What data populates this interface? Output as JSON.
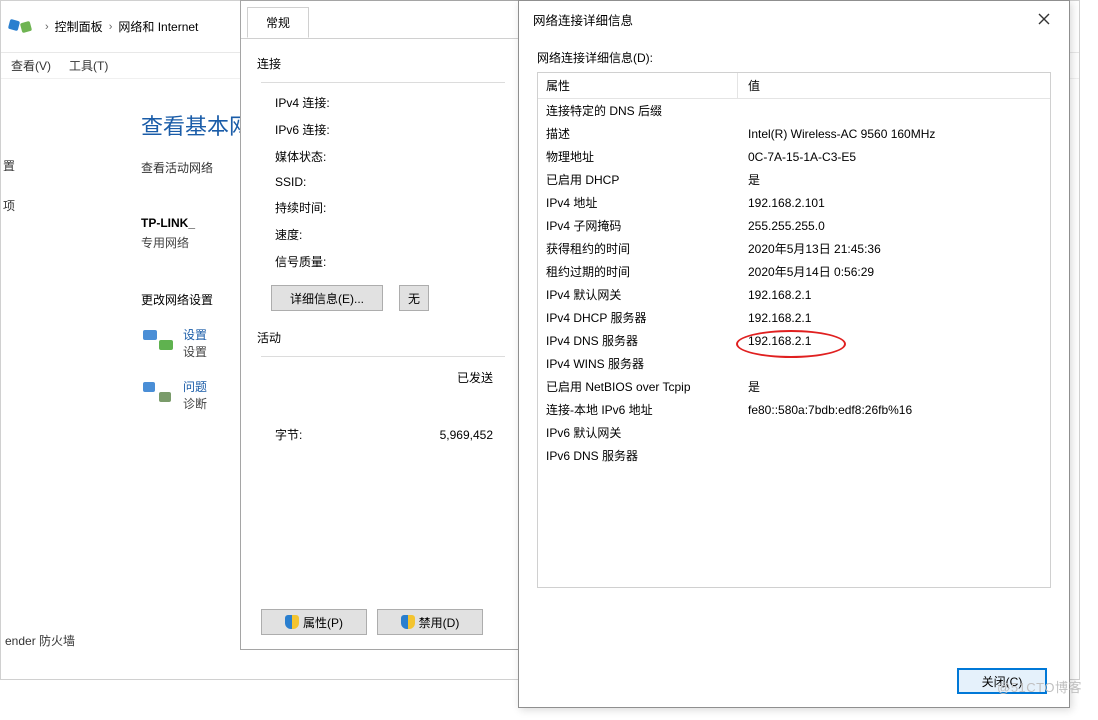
{
  "bg": {
    "breadcrumb": {
      "item1": "控制面板",
      "item2": "网络和 Internet"
    },
    "menu": {
      "view": "查看(V)",
      "tools": "工具(T)"
    },
    "heading": "查看基本网",
    "sub": "查看活动网络",
    "ssid_label": "TP-LINK_",
    "ssid_sub": "专用网络",
    "section": "更改网络设置",
    "link1": "设置",
    "link1_sub": "设置",
    "link2": "问题",
    "link2_sub": "诊断",
    "left": {
      "a": "置",
      "b": "项"
    },
    "footer": "ender 防火墙"
  },
  "mid": {
    "tab": "常规",
    "conn_title": "连接",
    "rows": {
      "ipv4": "IPv4 连接:",
      "ipv6": "IPv6 连接:",
      "media": "媒体状态:",
      "ssid": "SSID:",
      "duration": "持续时间:",
      "speed": "速度:",
      "signal": "信号质量:"
    },
    "btn_details": "详细信息(E)...",
    "btn_wireless_prefix": "无",
    "activity_title": "活动",
    "sent_label": "已发送",
    "bytes_label": "字节:",
    "bytes_sent": "5,969,452",
    "btn_props": "属性(P)",
    "btn_disable": "禁用(D)"
  },
  "front": {
    "title": "网络连接详细信息",
    "list_label": "网络连接详细信息(D):",
    "col_prop": "属性",
    "col_val": "值",
    "rows": [
      {
        "p": "连接特定的 DNS 后缀",
        "v": ""
      },
      {
        "p": "描述",
        "v": "Intel(R) Wireless-AC 9560 160MHz"
      },
      {
        "p": "物理地址",
        "v": "0C-7A-15-1A-C3-E5"
      },
      {
        "p": "已启用 DHCP",
        "v": "是"
      },
      {
        "p": "IPv4 地址",
        "v": "192.168.2.101"
      },
      {
        "p": "IPv4 子网掩码",
        "v": "255.255.255.0"
      },
      {
        "p": "获得租约的时间",
        "v": "2020年5月13日 21:45:36"
      },
      {
        "p": "租约过期的时间",
        "v": "2020年5月14日 0:56:29"
      },
      {
        "p": "IPv4 默认网关",
        "v": "192.168.2.1"
      },
      {
        "p": "IPv4 DHCP 服务器",
        "v": "192.168.2.1"
      },
      {
        "p": "IPv4 DNS 服务器",
        "v": "192.168.2.1"
      },
      {
        "p": "IPv4 WINS 服务器",
        "v": ""
      },
      {
        "p": "已启用 NetBIOS over Tcpip",
        "v": "是"
      },
      {
        "p": "连接-本地 IPv6 地址",
        "v": "fe80::580a:7bdb:edf8:26fb%16"
      },
      {
        "p": "IPv6 默认网关",
        "v": ""
      },
      {
        "p": "IPv6 DNS 服务器",
        "v": ""
      }
    ],
    "btn_close": "关闭(C)"
  },
  "watermark": "@51CTO博客"
}
